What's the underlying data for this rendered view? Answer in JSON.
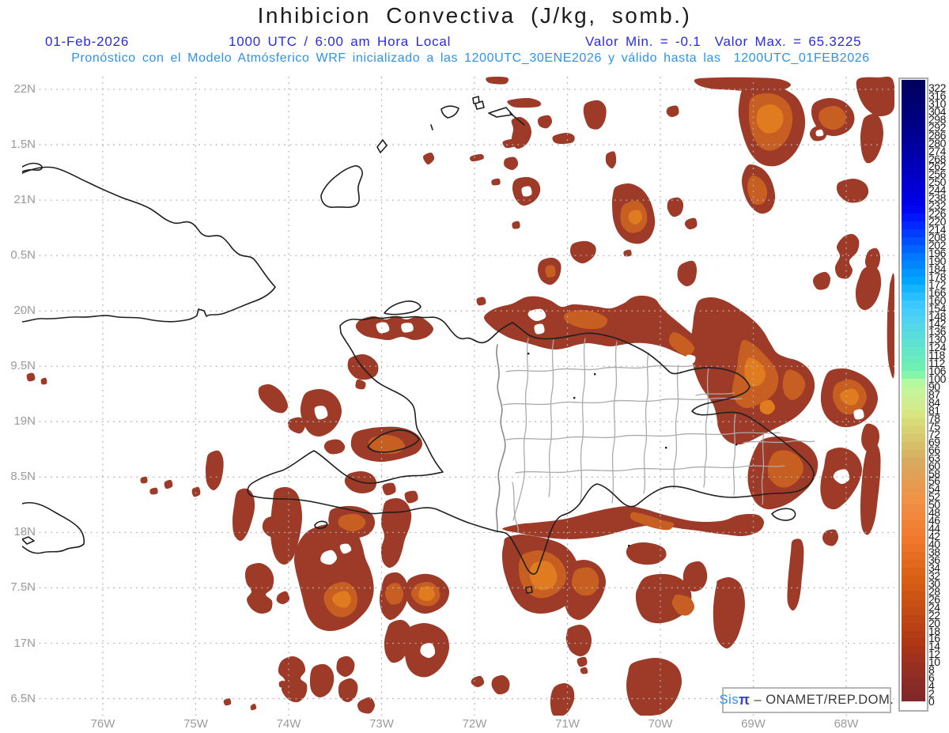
{
  "header": {
    "title": "Inhibicion Convectiva (J/kg, somb.)",
    "date": "01-Feb-2026",
    "time": "1000 UTC / 6:00 am Hora Local",
    "minmax": "Valor Min. = -0.1  Valor Max. = 65.3225",
    "forecast_line": "Pronóstico con el Modelo Atmósferico WRF inicializado a las 1200UTC_30ENE2026 y válido hasta las  1200UTC_01FEB2026"
  },
  "attribution": {
    "brand": "Sis",
    "symbol": "π",
    "separator": "– ",
    "org": "ONAMET/REP.DOM."
  },
  "axes": {
    "lat_labels": [
      "22N",
      "1.5N",
      "21N",
      "0.5N",
      "20N",
      "9.5N",
      "19N",
      "8.5N",
      "18N",
      "7.5N",
      "17N",
      "6.5N"
    ],
    "lon_labels": [
      "76W",
      "75W",
      "74W",
      "73W",
      "72W",
      "71W",
      "70W",
      "69W",
      "68W"
    ]
  },
  "colors": {
    "title_text": "#1c1c1c",
    "subtitle_blue": "#2a2ae8",
    "forecast_cyan": "#2e93ea",
    "axis_gray": "#9b9b9b",
    "grid_gray": "#b3b3b3",
    "coast_black": "#1f1f1f",
    "border_gray": "#8a8a8a",
    "province_gray": "#ababab",
    "shade_dark": "#9d3a28",
    "shade_orange": "#c75f22",
    "shade_bright": "#e07c1f",
    "sea_white": "#ffffff",
    "cbar_label": "#191919",
    "attrib_text": "#3a3a3a",
    "attrib_brand": "#2f8ff0",
    "attrib_symbol": "#3b3bf0"
  },
  "colorbar": {
    "labels": [
      "322",
      "316",
      "310",
      "304",
      "298",
      "292",
      "286",
      "280",
      "274",
      "268",
      "262",
      "256",
      "250",
      "244",
      "238",
      "232",
      "226",
      "220",
      "214",
      "208",
      "202",
      "196",
      "190",
      "184",
      "178",
      "172",
      "166",
      "160",
      "154",
      "148",
      "142",
      "136",
      "130",
      "124",
      "118",
      "112",
      "106",
      "100",
      "90",
      "87",
      "84",
      "81",
      "78",
      "75",
      "72",
      "69",
      "66",
      "63",
      "60",
      "58",
      "56",
      "54",
      "52",
      "50",
      "48",
      "46",
      "44",
      "42",
      "40",
      "38",
      "36",
      "34",
      "32",
      "30",
      "28",
      "26",
      "24",
      "22",
      "20",
      "18",
      "16",
      "14",
      "12",
      "10",
      "8",
      "6",
      "4",
      "2",
      "0"
    ],
    "cell_colors": [
      "#00005f",
      "#000066",
      "#00006e",
      "#000076",
      "#00007e",
      "#000086",
      "#00008e",
      "#000096",
      "#0000a0",
      "#0000aa",
      "#0000b4",
      "#0000be",
      "#0000c8",
      "#0000d2",
      "#0000dc",
      "#0000e6",
      "#0008f0",
      "#0016fa",
      "#0028ff",
      "#003cff",
      "#0050ff",
      "#0064ff",
      "#0078ff",
      "#0087ff",
      "#0096ff",
      "#00a5ff",
      "#14b4ff",
      "#28beff",
      "#3cc8ff",
      "#46cdf8",
      "#50d2f0",
      "#55d7e6",
      "#5adcdc",
      "#5fe1d2",
      "#64e6c8",
      "#69ebbe",
      "#6ef0b4",
      "#86f5aa",
      "#b4f8a0",
      "#c3f59b",
      "#cdf096",
      "#d2eb8c",
      "#d7e682",
      "#d7dc78",
      "#d7d273",
      "#d7c86e",
      "#d7be69",
      "#d7b464",
      "#d7aa5f",
      "#dca55a",
      "#e1a055",
      "#e69b50",
      "#eb964b",
      "#f09146",
      "#f08c41",
      "#f0873c",
      "#f08237",
      "#f07d32",
      "#f0782d",
      "#eb7328",
      "#e66e23",
      "#e1691e",
      "#dc6419",
      "#d75f14",
      "#d25a14",
      "#cd5514",
      "#c85014",
      "#c34b14",
      "#be4614",
      "#b94114",
      "#b43c14",
      "#af3714",
      "#a83418",
      "#a0311c",
      "#983020",
      "#922e24",
      "#8c2c26",
      "#862a28",
      "#80282a",
      "#ffffff"
    ]
  },
  "map_meta": {
    "variable": "Convective Inhibition (J/kg, shaded)",
    "value_min": -0.1,
    "value_max": 65.3225
  }
}
